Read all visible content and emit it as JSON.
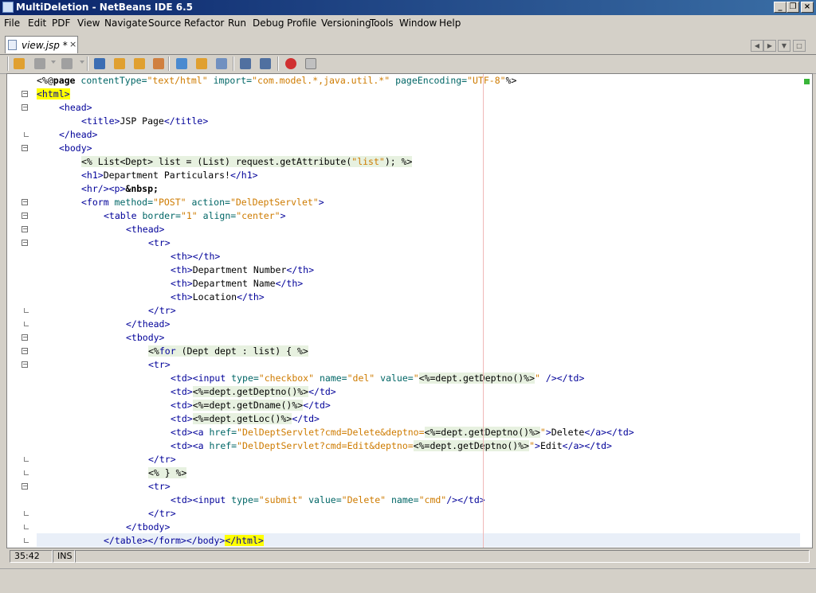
{
  "window": {
    "title": "MultiDeletion - NetBeans IDE 6.5"
  },
  "menu": [
    "File",
    "Edit",
    "PDF",
    "View",
    "Navigate",
    "Source",
    "Refactor",
    "Run",
    "Debug",
    "Profile",
    "Versioning",
    "Tools",
    "Window",
    "Help"
  ],
  "tab": {
    "label": "view.jsp *",
    "close": "×"
  },
  "statusbar": {
    "position": "35:42",
    "mode": "INS"
  },
  "colors": {
    "tag": "#000099",
    "attribute": "#006666",
    "string": "#ce7b00",
    "match_highlight": "#ffff00",
    "scriptlet_bg": "#e7f1e0",
    "current_line": "#e9eff8"
  },
  "toolbar_icons": [
    "back-history-icon",
    "last-edit-icon",
    "forward-history-icon",
    "find-selection-icon",
    "find-previous-icon",
    "find-next-icon",
    "toggle-highlight-icon",
    "previous-bookmark-icon",
    "next-bookmark-icon",
    "toggle-bookmark-icon",
    "shift-left-icon",
    "shift-right-icon",
    "record-macro-icon",
    "stop-macro-icon"
  ],
  "code_lines": [
    {
      "indent": 0,
      "fold": "none",
      "segs": [
        [
          "<%@",
          "t"
        ],
        [
          "page",
          "b"
        ],
        [
          " contentType=",
          "a"
        ],
        [
          "\"text/html\"",
          "s"
        ],
        [
          " import=",
          "a"
        ],
        [
          "\"com.model.*,java.util.*\"",
          "s"
        ],
        [
          " pageEncoding=",
          "a"
        ],
        [
          "\"UTF-8\"",
          "s"
        ],
        [
          "%>",
          "t"
        ]
      ]
    },
    {
      "indent": 0,
      "fold": "open",
      "segs": [
        [
          "<html>",
          "m"
        ]
      ]
    },
    {
      "indent": 1,
      "fold": "open",
      "segs": [
        [
          "<head>",
          "k"
        ]
      ]
    },
    {
      "indent": 2,
      "fold": "none",
      "segs": [
        [
          "<title>",
          "k"
        ],
        [
          "JSP Page",
          "t"
        ],
        [
          "</title>",
          "k"
        ]
      ]
    },
    {
      "indent": 1,
      "fold": "end",
      "segs": [
        [
          "</head>",
          "k"
        ]
      ]
    },
    {
      "indent": 1,
      "fold": "open",
      "segs": [
        [
          "<body>",
          "k"
        ]
      ]
    },
    {
      "indent": 2,
      "fold": "none",
      "segs": [
        [
          "<% List<Dept> list = (List) request.getAttribute(",
          "c"
        ],
        [
          "\"list\"",
          "cs"
        ],
        [
          "); %>",
          "c"
        ]
      ]
    },
    {
      "indent": 2,
      "fold": "none",
      "segs": [
        [
          "<h1>",
          "k"
        ],
        [
          "Department Particulars!",
          "t"
        ],
        [
          "</h1>",
          "k"
        ]
      ]
    },
    {
      "indent": 2,
      "fold": "none",
      "segs": [
        [
          "<hr/>",
          "k"
        ],
        [
          "<p>",
          "k"
        ],
        [
          "&nbsp;",
          "b"
        ]
      ]
    },
    {
      "indent": 2,
      "fold": "open",
      "segs": [
        [
          "<form",
          "k"
        ],
        [
          " method=",
          "a"
        ],
        [
          "\"POST\"",
          "s"
        ],
        [
          " action=",
          "a"
        ],
        [
          "\"DelDeptServlet\"",
          "s"
        ],
        [
          ">",
          "k"
        ]
      ]
    },
    {
      "indent": 3,
      "fold": "open",
      "segs": [
        [
          "<table",
          "k"
        ],
        [
          " border=",
          "a"
        ],
        [
          "\"1\"",
          "s"
        ],
        [
          " align=",
          "a"
        ],
        [
          "\"center\"",
          "s"
        ],
        [
          ">",
          "k"
        ]
      ]
    },
    {
      "indent": 4,
      "fold": "open",
      "segs": [
        [
          "<thead>",
          "k"
        ]
      ]
    },
    {
      "indent": 5,
      "fold": "open",
      "segs": [
        [
          "<tr>",
          "k"
        ]
      ]
    },
    {
      "indent": 6,
      "fold": "none",
      "segs": [
        [
          "<th></th>",
          "k"
        ]
      ]
    },
    {
      "indent": 6,
      "fold": "none",
      "segs": [
        [
          "<th>",
          "k"
        ],
        [
          "Department Number",
          "t"
        ],
        [
          "</th>",
          "k"
        ]
      ]
    },
    {
      "indent": 6,
      "fold": "none",
      "segs": [
        [
          "<th>",
          "k"
        ],
        [
          "Department Name",
          "t"
        ],
        [
          "</th>",
          "k"
        ]
      ]
    },
    {
      "indent": 6,
      "fold": "none",
      "segs": [
        [
          "<th>",
          "k"
        ],
        [
          "Location",
          "t"
        ],
        [
          "</th>",
          "k"
        ]
      ]
    },
    {
      "indent": 5,
      "fold": "end",
      "segs": [
        [
          "</tr>",
          "k"
        ]
      ]
    },
    {
      "indent": 4,
      "fold": "end",
      "segs": [
        [
          "</thead>",
          "k"
        ]
      ]
    },
    {
      "indent": 4,
      "fold": "open",
      "segs": [
        [
          "<tbody>",
          "k"
        ]
      ]
    },
    {
      "indent": 5,
      "fold": "open",
      "segs": [
        [
          "<%",
          "c"
        ],
        [
          "for",
          "ck"
        ],
        [
          " (Dept dept : list) { %>",
          "c"
        ]
      ]
    },
    {
      "indent": 5,
      "fold": "open",
      "segs": [
        [
          "<tr>",
          "k"
        ]
      ]
    },
    {
      "indent": 6,
      "fold": "none",
      "segs": [
        [
          "<td>",
          "k"
        ],
        [
          "<input",
          "k"
        ],
        [
          " type=",
          "a"
        ],
        [
          "\"checkbox\"",
          "s"
        ],
        [
          " name=",
          "a"
        ],
        [
          "\"del\"",
          "s"
        ],
        [
          " value=",
          "a"
        ],
        [
          "\"",
          "s"
        ],
        [
          "<%=dept.getDeptno()%>",
          "c"
        ],
        [
          "\"",
          "s"
        ],
        [
          " />",
          "k"
        ],
        [
          "</td>",
          "k"
        ]
      ]
    },
    {
      "indent": 6,
      "fold": "none",
      "segs": [
        [
          "<td>",
          "k"
        ],
        [
          "<%=dept.getDeptno()%>",
          "c"
        ],
        [
          "</td>",
          "k"
        ]
      ]
    },
    {
      "indent": 6,
      "fold": "none",
      "segs": [
        [
          "<td>",
          "k"
        ],
        [
          "<%=dept.getDname()%>",
          "c"
        ],
        [
          "</td>",
          "k"
        ]
      ]
    },
    {
      "indent": 6,
      "fold": "none",
      "segs": [
        [
          "<td>",
          "k"
        ],
        [
          "<%=dept.getLoc()%>",
          "c"
        ],
        [
          "</td>",
          "k"
        ]
      ]
    },
    {
      "indent": 6,
      "fold": "none",
      "segs": [
        [
          "<td>",
          "k"
        ],
        [
          "<a",
          "k"
        ],
        [
          " href=",
          "a"
        ],
        [
          "\"DelDeptServlet?cmd=Delete&deptno=",
          "s"
        ],
        [
          "<%=dept.getDeptno()%>",
          "c"
        ],
        [
          "\"",
          "s"
        ],
        [
          ">",
          "k"
        ],
        [
          "Delete",
          "t"
        ],
        [
          "</a>",
          "k"
        ],
        [
          "</td>",
          "k"
        ]
      ]
    },
    {
      "indent": 6,
      "fold": "none",
      "segs": [
        [
          "<td>",
          "k"
        ],
        [
          "<a",
          "k"
        ],
        [
          " href=",
          "a"
        ],
        [
          "\"DelDeptServlet?cmd=Edit&deptno=",
          "s"
        ],
        [
          "<%=dept.getDeptno()%>",
          "c"
        ],
        [
          "\"",
          "s"
        ],
        [
          ">",
          "k"
        ],
        [
          "Edit",
          "t"
        ],
        [
          "</a>",
          "k"
        ],
        [
          "</td>",
          "k"
        ]
      ]
    },
    {
      "indent": 5,
      "fold": "end",
      "segs": [
        [
          "</tr>",
          "k"
        ]
      ]
    },
    {
      "indent": 5,
      "fold": "end",
      "segs": [
        [
          "<% } %>",
          "c"
        ]
      ]
    },
    {
      "indent": 5,
      "fold": "open",
      "segs": [
        [
          "<tr>",
          "k"
        ]
      ]
    },
    {
      "indent": 6,
      "fold": "none",
      "segs": [
        [
          "<td>",
          "k"
        ],
        [
          "<input",
          "k"
        ],
        [
          " type=",
          "a"
        ],
        [
          "\"submit\"",
          "s"
        ],
        [
          " value=",
          "a"
        ],
        [
          "\"Delete\"",
          "s"
        ],
        [
          " name=",
          "a"
        ],
        [
          "\"cmd\"",
          "s"
        ],
        [
          "/>",
          "k"
        ],
        [
          "</td>",
          "k"
        ]
      ]
    },
    {
      "indent": 5,
      "fold": "end",
      "segs": [
        [
          "</tr>",
          "k"
        ]
      ]
    },
    {
      "indent": 4,
      "fold": "end",
      "segs": [
        [
          "</tbody>",
          "k"
        ]
      ]
    },
    {
      "indent": 3,
      "fold": "end",
      "segs": [
        [
          "</table>",
          "k"
        ],
        [
          "</form>",
          "k"
        ],
        [
          "</body>",
          "k"
        ],
        [
          "</html>",
          "m"
        ]
      ]
    }
  ]
}
